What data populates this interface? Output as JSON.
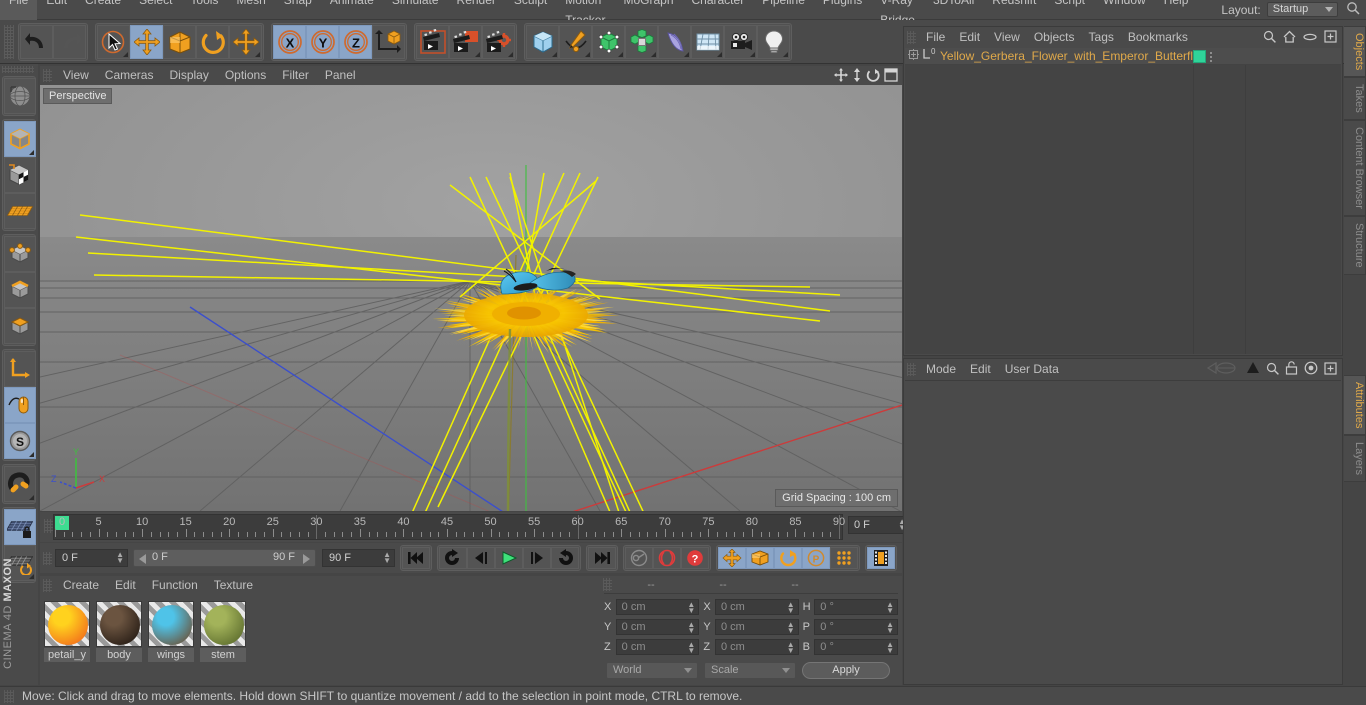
{
  "app": {
    "brand_maxon": "MAXON",
    "brand_product": "CINEMA 4D"
  },
  "menubar": {
    "items": [
      "File",
      "Edit",
      "Create",
      "Select",
      "Tools",
      "Mesh",
      "Snap",
      "Animate",
      "Simulate",
      "Render",
      "Sculpt",
      "Motion Tracker",
      "MoGraph",
      "Character",
      "Pipeline",
      "Plugins",
      "V-Ray Bridge",
      "3DToAll",
      "Redshift",
      "Script",
      "Window",
      "Help"
    ],
    "layout_label": "Layout:",
    "layout_value": "Startup",
    "search_icon": "magnifier-icon"
  },
  "toolbar": {
    "undo": "undo-icon",
    "redo": "redo-icon",
    "select": "live-selection-icon",
    "move": "move-icon",
    "scale": "scale-icon",
    "rotate": "rotate-icon",
    "move2": "move-axis-icon",
    "lock_x": "X",
    "lock_y": "Y",
    "lock_z": "Z",
    "world_coord": "world-object-axis-icon",
    "render_view": "render-view-icon",
    "render_region": "render-region-icon",
    "render_settings": "render-settings-icon",
    "cube": "add-cube-icon",
    "spline": "add-spline-icon",
    "nurbs": "add-generator-icon",
    "array": "add-modeling-object-icon",
    "deformer": "add-deformer-icon",
    "scene": "add-environment-icon",
    "camera": "add-camera-icon",
    "light": "add-light-icon"
  },
  "lefttool": {
    "items": [
      {
        "name": "undo-view-icon",
        "active": false
      },
      {
        "name": "model-mode-icon",
        "active": true
      },
      {
        "name": "texture-mode-icon",
        "active": false
      },
      {
        "name": "polygon-mesh-icon",
        "active": false
      },
      {
        "name": "points-mode-icon",
        "active": false
      },
      {
        "name": "edges-mode-icon",
        "active": false
      },
      {
        "name": "polygons-mode-icon",
        "active": false
      },
      {
        "name": "axis-modify-icon",
        "active": false
      },
      {
        "name": "enable-snapping-icon",
        "active": true
      },
      {
        "name": "snap-settings-icon",
        "active": true
      },
      {
        "name": "magnet-icon",
        "active": false
      },
      {
        "name": "workplane-lock-icon",
        "active": true
      },
      {
        "name": "workplane-rotate-icon",
        "active": false
      }
    ]
  },
  "viewport": {
    "menu": [
      "View",
      "Cameras",
      "Display",
      "Options",
      "Filter",
      "Panel"
    ],
    "label": "Perspective",
    "grid_spacing": "Grid Spacing : 100 cm",
    "axis": {
      "x": "X",
      "y": "Y",
      "z": "Z"
    },
    "icons": [
      "viewport-move-icon",
      "viewport-scale-icon",
      "viewport-rotate-icon",
      "viewport-maximize-icon"
    ],
    "colors": {
      "axis_x": "#cc3b3b",
      "axis_y": "#3fbf3f",
      "axis_z": "#3b4fcc",
      "spline": "#f2f200"
    }
  },
  "timeline": {
    "ticks": [
      0,
      5,
      10,
      15,
      20,
      25,
      30,
      35,
      40,
      45,
      50,
      55,
      60,
      65,
      70,
      75,
      80,
      85,
      90
    ],
    "min": 0,
    "max": 90,
    "current_field": "0 F",
    "current_frame": "0 F",
    "range_start": "0 F",
    "range_end": "90 F",
    "doc_end": "90 F",
    "buttons": [
      "go-to-start-icon",
      "play-reverse-loop-icon",
      "frame-back-icon",
      "play-icon",
      "frame-forward-icon",
      "loop-icon",
      "go-to-end-icon",
      "autokey-icon",
      "record-icon",
      "help-record-icon",
      "record-position-icon",
      "record-scale-icon",
      "record-rotation-icon",
      "record-param-icon",
      "record-pla-icon",
      "timeline-icon"
    ]
  },
  "materials": {
    "menu": [
      "Create",
      "Edit",
      "Function",
      "Texture"
    ],
    "items": [
      {
        "name": "petail_y",
        "color1": "#ffd21e",
        "color2": "#f26a1b"
      },
      {
        "name": "body",
        "color1": "#6b5440",
        "color2": "#241a13"
      },
      {
        "name": "wings",
        "color1": "#4fc3e8",
        "color2": "#6b5238"
      },
      {
        "name": "stem",
        "color1": "#a3b35a",
        "color2": "#5b6b2c"
      }
    ]
  },
  "coordinates": {
    "headers": [
      "--",
      "--",
      "--"
    ],
    "rows": [
      {
        "l1": "X",
        "v1": "0 cm",
        "l2": "X",
        "v2": "0 cm",
        "l3": "H",
        "v3": "0 °"
      },
      {
        "l1": "Y",
        "v1": "0 cm",
        "l2": "Y",
        "v2": "0 cm",
        "l3": "P",
        "v3": "0 °"
      },
      {
        "l1": "Z",
        "v1": "0 cm",
        "l2": "Z",
        "v2": "0 cm",
        "l3": "B",
        "v3": "0 °"
      }
    ],
    "system": "World",
    "mode": "Scale",
    "apply": "Apply"
  },
  "object_manager": {
    "menu": [
      "File",
      "Edit",
      "View",
      "Objects",
      "Tags",
      "Bookmarks"
    ],
    "icons": [
      "search-icon",
      "home-icon",
      "ellipse-icon",
      "add-layer-icon"
    ],
    "objects": [
      {
        "name": "Yellow_Gerbera_Flower_with_Emperor_Butterfly",
        "tag_color": "#2fd49a",
        "level": "0"
      }
    ]
  },
  "attribute_manager": {
    "menu": [
      "Mode",
      "Edit",
      "User Data"
    ],
    "icons": [
      "history-icon",
      "pin-icon",
      "search-icon",
      "lock-icon",
      "target-icon",
      "add-icon"
    ]
  },
  "right_tabs": [
    {
      "label": "Objects",
      "active": true
    },
    {
      "label": "Takes",
      "active": false
    },
    {
      "label": "Content Browser",
      "active": false
    },
    {
      "label": "Structure",
      "active": false
    },
    {
      "label": "Attributes",
      "active": true
    },
    {
      "label": "Layers",
      "active": false
    }
  ],
  "statusbar": {
    "message": "Move: Click and drag to move elements. Hold down SHIFT to quantize movement / add to the selection in point mode, CTRL to remove."
  }
}
